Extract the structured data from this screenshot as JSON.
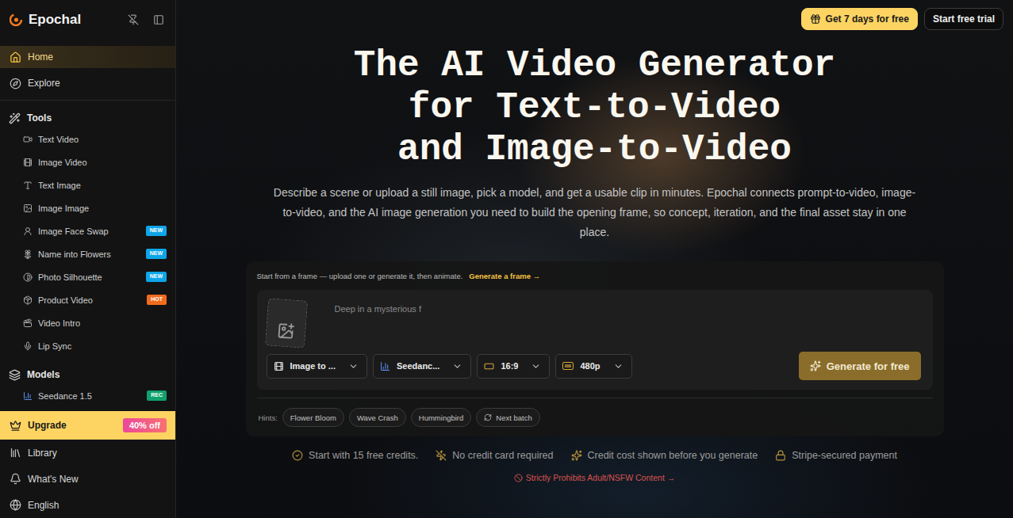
{
  "brand": {
    "name": "Epochal"
  },
  "nav": [
    {
      "label": "Home",
      "selected": true
    },
    {
      "label": "Explore",
      "selected": false
    }
  ],
  "tools": {
    "title": "Tools",
    "items": [
      {
        "label": "Text Video"
      },
      {
        "label": "Image Video"
      },
      {
        "label": "Text Image"
      },
      {
        "label": "Image Image"
      },
      {
        "label": "Image Face Swap",
        "badge": {
          "text": "NEW",
          "color": "#0ea5e9"
        }
      },
      {
        "label": "Name into Flowers",
        "badge": {
          "text": "NEW",
          "color": "#0ea5e9"
        }
      },
      {
        "label": "Photo Silhouette",
        "badge": {
          "text": "NEW",
          "color": "#0ea5e9"
        }
      },
      {
        "label": "Product Video",
        "badge": {
          "text": "HOT",
          "color": "#f26b1d"
        }
      },
      {
        "label": "Video Intro"
      },
      {
        "label": "Lip Sync"
      }
    ]
  },
  "models": {
    "title": "Models",
    "items": [
      {
        "label": "Seedance 1.5",
        "badge": {
          "text": "REC",
          "color": "#10a06b"
        }
      }
    ]
  },
  "upgrade": {
    "label": "Upgrade",
    "badge": "40% off"
  },
  "bottom_nav": [
    {
      "label": "Library"
    },
    {
      "label": "What's New"
    },
    {
      "label": "English"
    }
  ],
  "topbar": {
    "buttons": [
      {
        "label": "Get 7 days for free",
        "kind": "primary"
      },
      {
        "label": "Start free trial",
        "kind": "secondary"
      }
    ]
  },
  "hero": {
    "title_lines": [
      "The AI Video Generator",
      "for Text-to-Video",
      "and Image-to-Video"
    ],
    "subtitle": "Describe a scene or upload a still image, pick a model, and get a usable clip in minutes. Epochal connects prompt-to-video, image-to-video, and the AI image generation you need to build the opening frame, so concept, iteration, and the final asset stay in one place."
  },
  "composer": {
    "intro": "Start from a frame — upload one or generate it, then animate.",
    "intro_link": "Generate a frame →",
    "placeholder": "Deep in a mysterious f",
    "selects": [
      {
        "label": "Image to ...",
        "kind": "mode"
      },
      {
        "label": "Seedanc...",
        "kind": "model"
      },
      {
        "label": "16:9",
        "kind": "ratio"
      },
      {
        "label": "480p",
        "kind": "resolution"
      }
    ],
    "generate_button": "Generate for free",
    "hints_label": "Hints:",
    "hints": [
      {
        "label": "Flower Bloom",
        "kind": "hint"
      },
      {
        "label": "Wave Crash",
        "kind": "hint"
      },
      {
        "label": "Hummingbird",
        "kind": "hint"
      },
      {
        "label": "Next batch",
        "kind": "refresh"
      }
    ]
  },
  "features": [
    {
      "label": "Start with 15 free credits."
    },
    {
      "label": "No credit card required"
    },
    {
      "label": "Credit cost shown before you generate"
    },
    {
      "label": "Stripe-secured payment"
    }
  ],
  "notice": "Strictly Prohibits Adult/NSFW Content →"
}
